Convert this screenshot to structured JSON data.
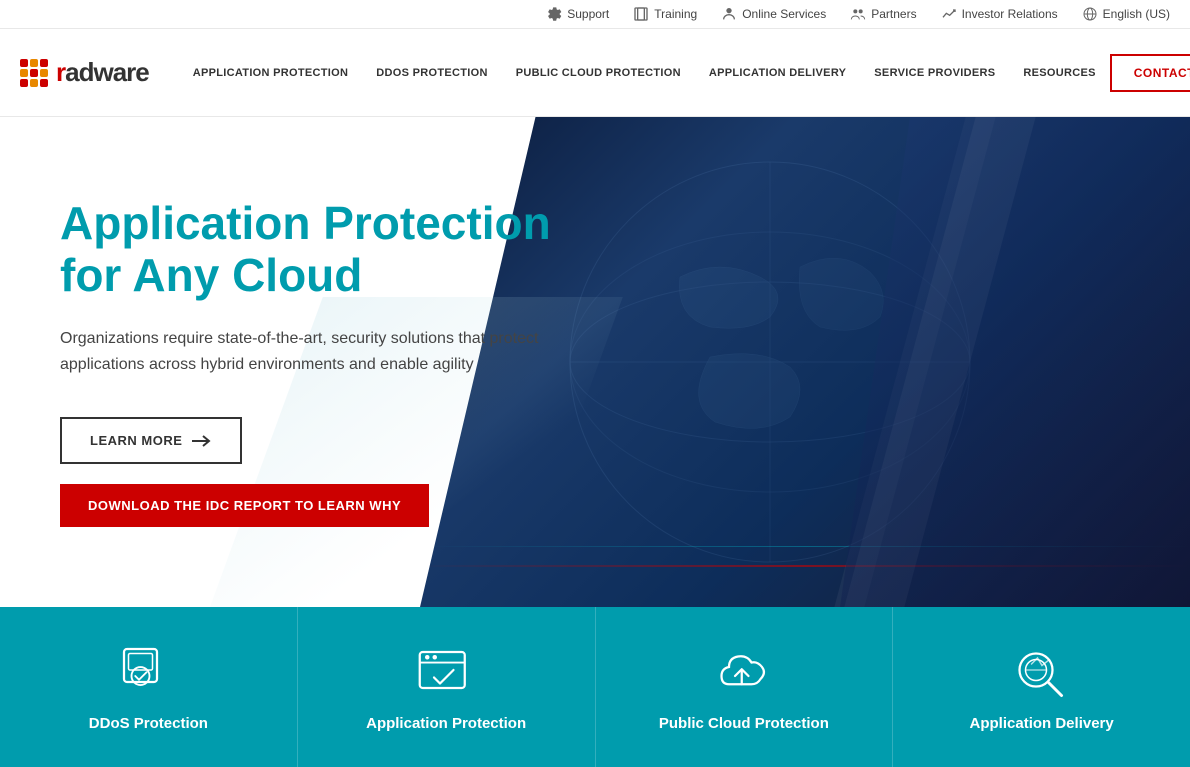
{
  "topbar": {
    "items": [
      {
        "id": "support",
        "label": "Support",
        "icon": "gear"
      },
      {
        "id": "training",
        "label": "Training",
        "icon": "book"
      },
      {
        "id": "online-services",
        "label": "Online Services",
        "icon": "person"
      },
      {
        "id": "partners",
        "label": "Partners",
        "icon": "people"
      },
      {
        "id": "investor-relations",
        "label": "Investor Relations",
        "icon": "chart"
      },
      {
        "id": "language",
        "label": "English (US)",
        "icon": "globe"
      }
    ]
  },
  "logo": {
    "text_radware": "radware"
  },
  "nav": {
    "links": [
      {
        "id": "app-protection",
        "label": "APPLICATION PROTECTION"
      },
      {
        "id": "ddos-protection",
        "label": "DDOS PROTECTION"
      },
      {
        "id": "public-cloud",
        "label": "PUBLIC CLOUD PROTECTION"
      },
      {
        "id": "app-delivery",
        "label": "APPLICATION DELIVERY"
      },
      {
        "id": "service-providers",
        "label": "SERVICE PROVIDERS"
      },
      {
        "id": "resources",
        "label": "RESOURCES"
      }
    ],
    "contact_label": "CONTACT"
  },
  "hero": {
    "title_line1": "Application Protection",
    "title_line2": "for Any Cloud",
    "subtitle": "Organizations require state-of-the-art, security solutions that protect applications across hybrid environments and enable agility",
    "btn_learn_more": "LEARN MORE",
    "btn_download": "DOWNLOAD THE IDC REPORT TO LEARN WHY"
  },
  "cards": [
    {
      "id": "ddos",
      "label": "DDoS Protection",
      "icon_type": "shield-check"
    },
    {
      "id": "app-protection",
      "label": "Application Protection",
      "icon_type": "browser-check"
    },
    {
      "id": "cloud-protection",
      "label": "Public Cloud Protection",
      "icon_type": "cloud-upload"
    },
    {
      "id": "app-delivery",
      "label": "Application Delivery",
      "icon_type": "search-analytics"
    }
  ],
  "logo_dots": {
    "colors": [
      "#cc0000",
      "#e88800",
      "#cc0000",
      "#e88800",
      "#cc0000",
      "#e88800",
      "#cc0000",
      "#e88800",
      "#cc0000"
    ]
  }
}
